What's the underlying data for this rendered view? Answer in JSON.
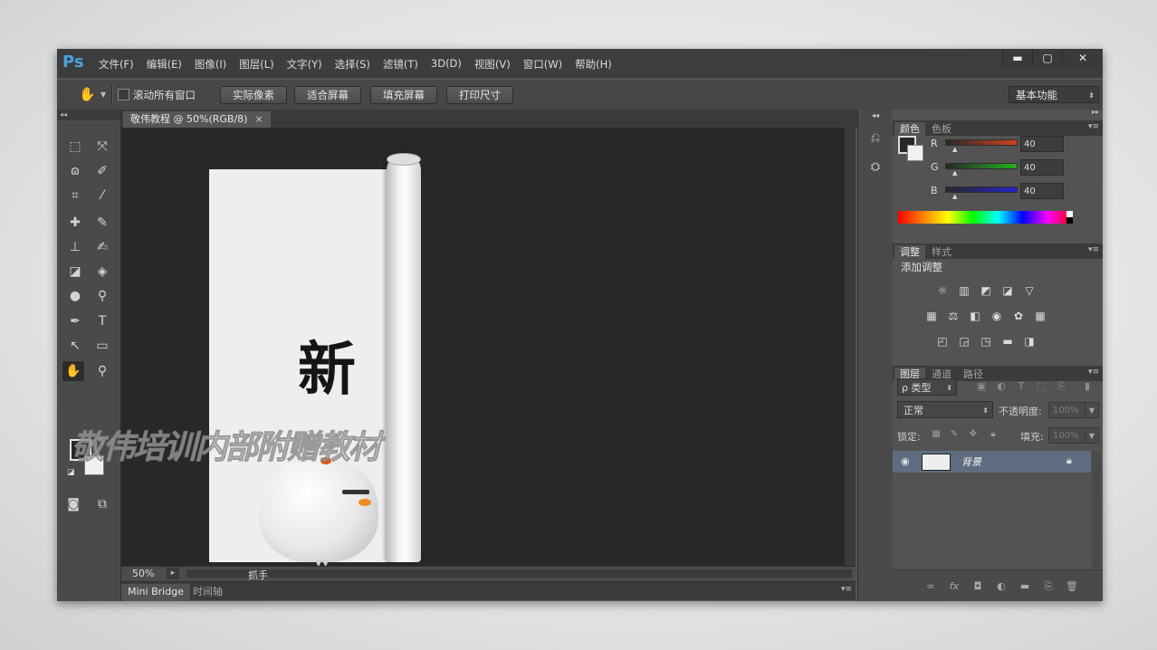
{
  "app": {
    "logo": "Ps"
  },
  "menu": [
    "文件(F)",
    "编辑(E)",
    "图像(I)",
    "图层(L)",
    "文字(Y)",
    "选择(S)",
    "滤镜(T)",
    "3D(D)",
    "视图(V)",
    "窗口(W)",
    "帮助(H)"
  ],
  "window_buttons": {
    "minimize": "▬",
    "maximize": "▢",
    "close": "✕"
  },
  "options": {
    "scroll_all_label": "滚动所有窗口",
    "buttons": [
      "实际像素",
      "适合屏幕",
      "填充屏幕",
      "打印尺寸"
    ],
    "workspace": "基本功能"
  },
  "document": {
    "tab_title": "敬伟教程 @ 50%(RGB/8)",
    "tab_close": "×",
    "big_char": "新",
    "watermark": "敬伟培训内部附赠教材",
    "zoom": "50%",
    "status_tool": "抓手"
  },
  "bottom_tabs": [
    "Mini Bridge",
    "时间轴"
  ],
  "color_panel": {
    "tabs": [
      "颜色",
      "色板"
    ],
    "channels": [
      {
        "label": "R",
        "value": "40",
        "gradient": "#d0441c"
      },
      {
        "label": "G",
        "value": "40",
        "gradient": "#22b21c"
      },
      {
        "label": "B",
        "value": "40",
        "gradient": "#2424c8"
      }
    ]
  },
  "adjust_panel": {
    "tabs": [
      "调整",
      "样式"
    ],
    "title": "添加调整",
    "icons_row1": [
      "brightness-icon",
      "levels-icon",
      "curves-icon",
      "exposure-icon",
      "vibrance-icon"
    ],
    "icons_row2": [
      "hue-saturation-icon",
      "color-balance-icon",
      "black-white-icon",
      "photo-filter-icon",
      "channel-mixer-icon",
      "color-lookup-icon"
    ],
    "icons_row3": [
      "invert-icon",
      "posterize-icon",
      "threshold-icon",
      "gradient-map-icon",
      "selective-color-icon"
    ]
  },
  "layers_panel": {
    "tabs": [
      "图层",
      "通道",
      "路径"
    ],
    "filter_label": "ρ 类型",
    "blend_mode": "正常",
    "opacity_label": "不透明度:",
    "opacity_value": "100%",
    "lock_label": "锁定:",
    "fill_label": "填充:",
    "fill_value": "100%",
    "layers": [
      {
        "name": "背景",
        "visible": true,
        "locked": true
      }
    ]
  }
}
